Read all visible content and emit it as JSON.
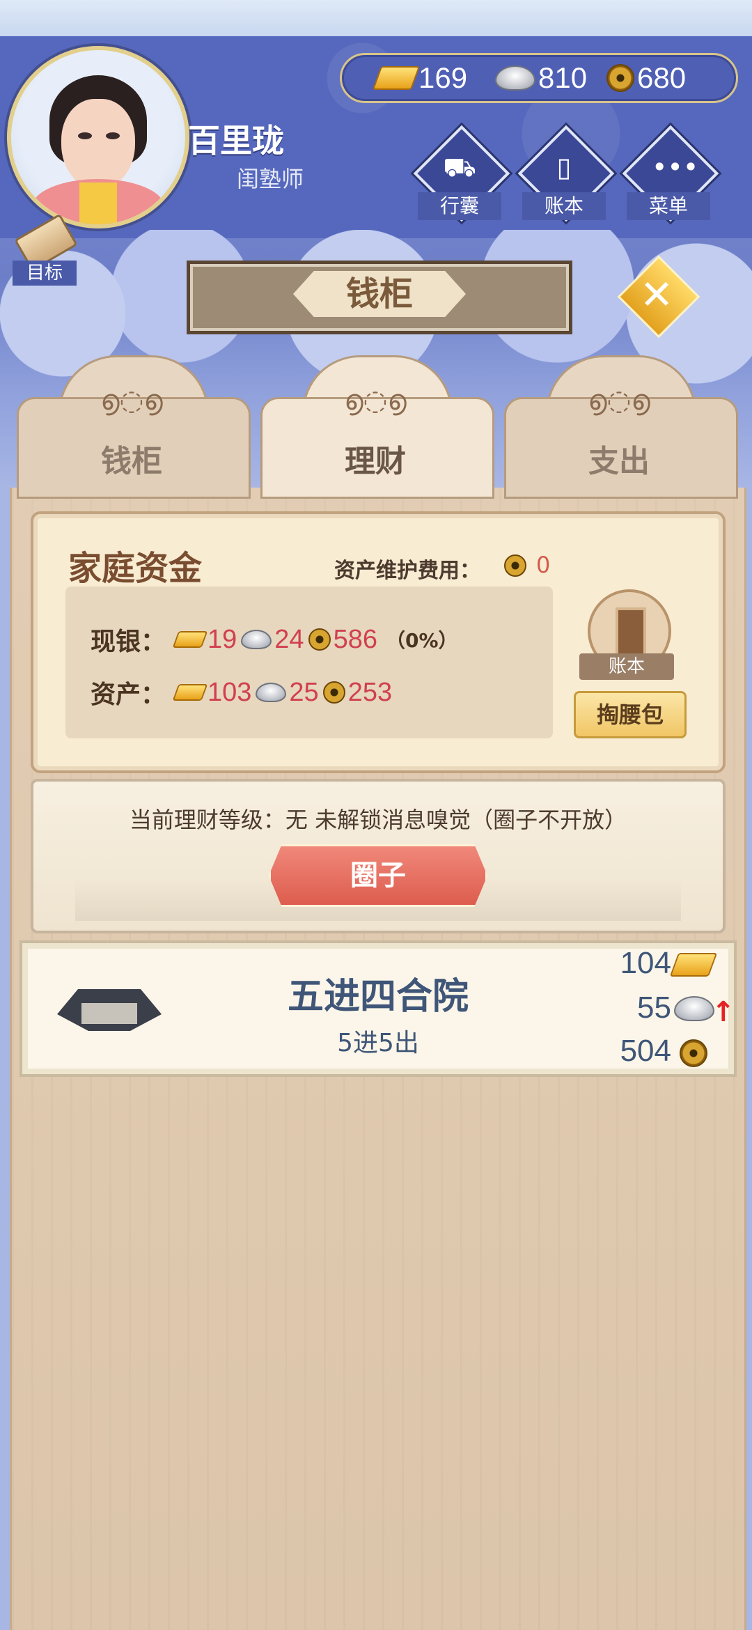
{
  "currency": {
    "gold": "169",
    "silver": "810",
    "copper": "680"
  },
  "player": {
    "name": "百里珑",
    "title": "闺塾师"
  },
  "menu": [
    {
      "label": "行囊",
      "icon": "bag-icon"
    },
    {
      "label": "账本",
      "icon": "ledger-icon"
    },
    {
      "label": "菜单",
      "icon": "more-icon"
    }
  ],
  "goal_label": "目标",
  "page_title": "钱柜",
  "tabs": [
    {
      "label": "钱柜",
      "active": false
    },
    {
      "label": "理财",
      "active": true
    },
    {
      "label": "支出",
      "active": false
    }
  ],
  "funds": {
    "title": "家庭资金",
    "maintenance_label": "资产维护费用：",
    "maintenance_value": "0",
    "cash_label": "现银：",
    "cash_gold": "19",
    "cash_silver": "24",
    "cash_copper": "586",
    "cash_pct": "（0%）",
    "assets_label": "资产：",
    "assets_gold": "103",
    "assets_silver": "25",
    "assets_copper": "253",
    "ledger_label": "账本",
    "pocket_button": "掏腰包"
  },
  "finance": {
    "info": "当前理财等级：无 未解锁消息嗅觉（圈子不开放）",
    "circle_button": "圈子"
  },
  "property": {
    "name": "五进四合院",
    "sub": "5进5出",
    "gold": "104",
    "silver": "55",
    "copper": "504"
  },
  "colors": {
    "accent_red": "#d0404e",
    "header_blue": "#5668bd",
    "text_blue": "#3f5678"
  }
}
